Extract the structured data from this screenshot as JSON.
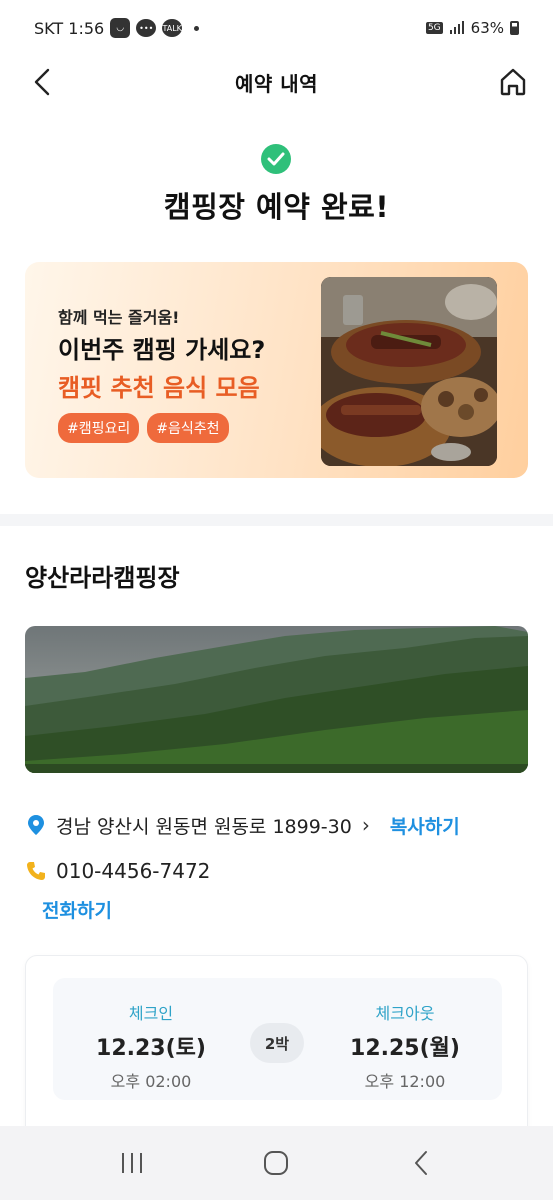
{
  "status_bar": {
    "carrier_time": "SKT 1:56",
    "talk_label": "TALK",
    "network": "5G",
    "battery": "63%"
  },
  "header": {
    "title": "예약 내역"
  },
  "completion": {
    "title": "캠핑장 예약 완료!"
  },
  "banner": {
    "subtitle": "함께 먹는 즐거움!",
    "title": "이번주 캠핑 가세요?",
    "highlight": "캠핏 추천 음식 모음",
    "tags": [
      "#캠핑요리",
      "#음식추천"
    ]
  },
  "site": {
    "name": "양산라라캠핑장",
    "address": "경남 양산시 원동면 원동로 1899-30",
    "copy_label": "복사하기",
    "phone": "010-4456-7472",
    "call_label": "전화하기"
  },
  "reservation": {
    "checkin_label": "체크인",
    "checkin_date": "12.23(토)",
    "checkin_time": "오후 02:00",
    "nights": "2박",
    "checkout_label": "체크아웃",
    "checkout_date": "12.25(월)",
    "checkout_time": "오후 12:00"
  },
  "colors": {
    "accent_blue": "#1e90e0",
    "success_green": "#2fc07a",
    "orange": "#e85d24",
    "teal_label": "#2fa3c8"
  },
  "icons": [
    "back-arrow-icon",
    "home-icon",
    "check-circle-icon",
    "location-pin-icon",
    "chevron-right-icon",
    "phone-icon",
    "recent-apps-icon",
    "home-nav-icon",
    "back-nav-icon"
  ]
}
